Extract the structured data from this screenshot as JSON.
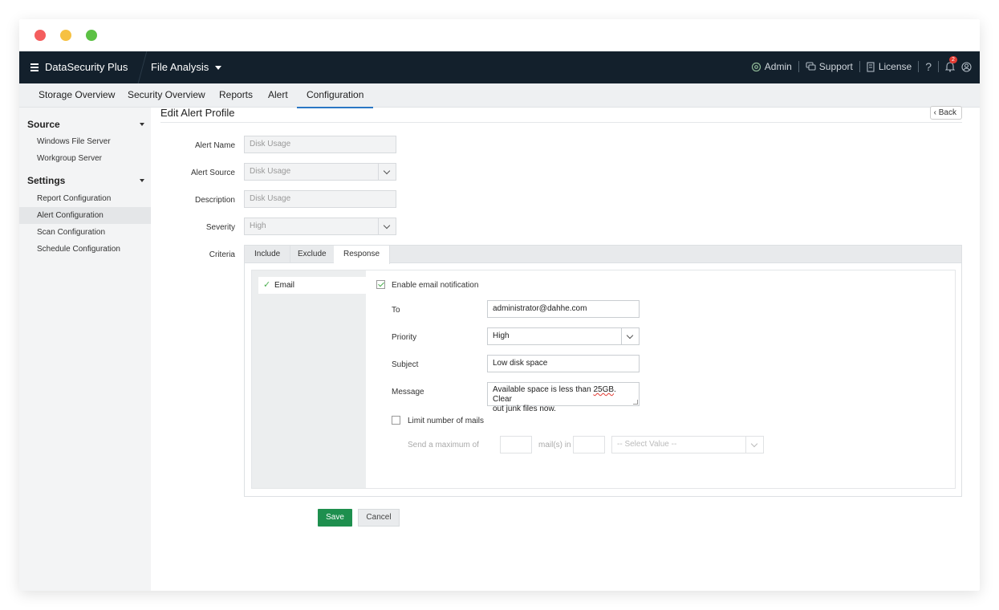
{
  "app": {
    "brand": "DataSecurity Plus",
    "module": "File Analysis",
    "top_right": {
      "admin": "Admin",
      "support": "Support",
      "license": "License",
      "help": "?",
      "notification_count": "2"
    }
  },
  "tabs": [
    "Storage Overview",
    "Security Overview",
    "Reports",
    "Alert",
    "Configuration"
  ],
  "active_tab": "Configuration",
  "sidebar": {
    "source_heading": "Source",
    "source_items": [
      "Windows File Server",
      "Workgroup Server"
    ],
    "settings_heading": "Settings",
    "settings_items": [
      "Report Configuration",
      "Alert Configuration",
      "Scan Configuration",
      "Schedule Configuration"
    ],
    "active_item": "Alert Configuration"
  },
  "page": {
    "title": "Edit Alert Profile",
    "back_label": "Back"
  },
  "form": {
    "alert_name_label": "Alert Name",
    "alert_name_value": "Disk Usage",
    "alert_source_label": "Alert Source",
    "alert_source_value": "Disk Usage",
    "description_label": "Description",
    "description_value": "Disk Usage",
    "severity_label": "Severity",
    "severity_value": "High",
    "criteria_label": "Criteria"
  },
  "criteria": {
    "tabs": [
      "Include",
      "Exclude",
      "Response"
    ],
    "active_tab": "Response",
    "response": {
      "channel": "Email",
      "enable_email_label": "Enable email notification",
      "enable_email_checked": true,
      "to_label": "To",
      "to_value": "administrator@dahhe.com",
      "priority_label": "Priority",
      "priority_value": "High",
      "subject_label": "Subject",
      "subject_value": "Low disk space",
      "message_label": "Message",
      "message_part1": "Available space is less than ",
      "message_spell": "25GB",
      "message_part2": ". Clear",
      "message_line2": "out junk files now.",
      "limit_label": "Limit number of mails",
      "limit_checked": false,
      "send_max_label": "Send a maximum of",
      "mails_in_label": "mail(s) in",
      "select_placeholder": "-- Select Value --"
    }
  },
  "buttons": {
    "save": "Save",
    "cancel": "Cancel"
  },
  "colors": {
    "appbar": "#13202c",
    "save_green": "#1e8f4e",
    "active_tab_underline": "#2b77c4",
    "check_green": "#4caf50",
    "badge_red": "#e23a32"
  }
}
